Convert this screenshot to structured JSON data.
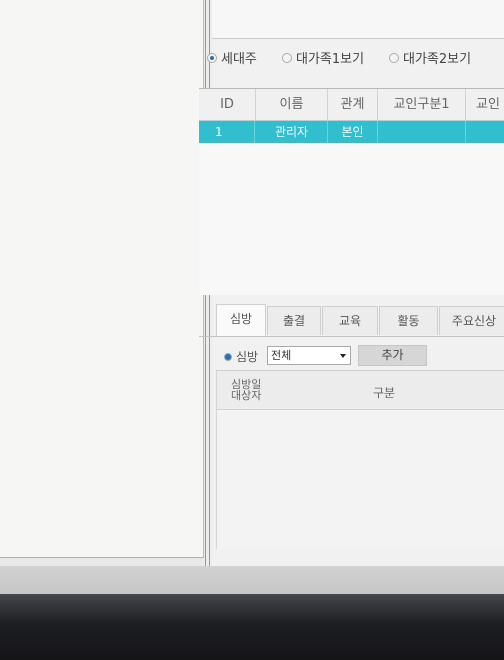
{
  "view_options": {
    "selected": "세대주",
    "items": [
      "세대주",
      "대가족1보기",
      "대가족2보기"
    ]
  },
  "member_grid": {
    "columns": [
      "ID",
      "이름",
      "관계",
      "교인구분1",
      "교인"
    ],
    "rows": [
      {
        "id": "1",
        "name": "관리자",
        "relation": "본인",
        "type1": "",
        "type2": ""
      }
    ],
    "selected_row_color": "#31bfcf"
  },
  "detail_tabs": {
    "active": "심방",
    "items": [
      "심방",
      "출결",
      "교육",
      "활동",
      "주요신상"
    ]
  },
  "visit_filter": {
    "label": "심방",
    "select_value": "전체",
    "add_label": "추가"
  },
  "visit_grid": {
    "columns": [
      "심방일\n대상자",
      "구분"
    ]
  }
}
